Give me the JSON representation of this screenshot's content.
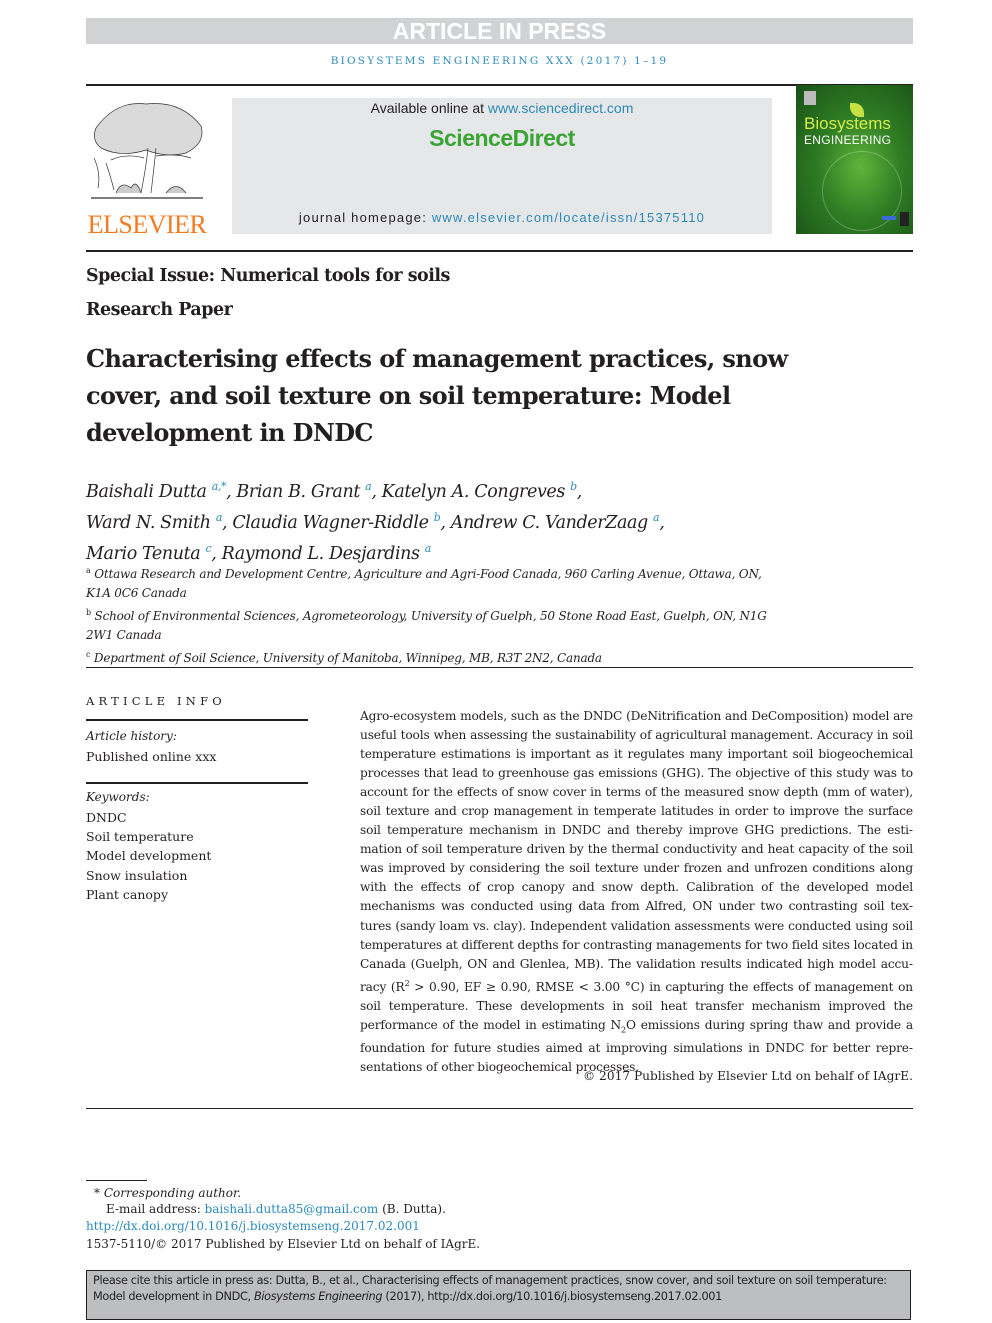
{
  "banner": {
    "article_in_press": "ARTICLE IN PRESS"
  },
  "running_head": "BIOSYSTEMS ENGINEERING XXX (2017) 1–19",
  "masthead": {
    "publisher_logo_text": "ELSEVIER",
    "available_online_prefix": "Available online at ",
    "available_online_url": "www.sciencedirect.com",
    "platform_name": "ScienceDirect",
    "journal_homepage_prefix": "journal homepage: ",
    "journal_homepage_url": "www.elsevier.com/locate/issn/15375110",
    "cover": {
      "title_line1": "Biosystems",
      "title_line2": "ENGINEERING"
    }
  },
  "article": {
    "special_issue": "Special Issue: Numerical tools for soils",
    "article_type": "Research Paper",
    "title": "Characterising effects of management practices, snow cover, and soil texture on soil temperature: Model development in DNDC",
    "authors": [
      {
        "name": "Baishali Dutta",
        "sup": "a,*",
        "sep": ", "
      },
      {
        "name": "Brian B. Grant",
        "sup": "a",
        "sep": ", "
      },
      {
        "name": "Katelyn A. Congreves",
        "sup": "b",
        "sep": ", "
      },
      {
        "name": "Ward N. Smith",
        "sup": "a",
        "sep": ", "
      },
      {
        "name": "Claudia Wagner-Riddle",
        "sup": "b",
        "sep": ", "
      },
      {
        "name": "Andrew C. VanderZaag",
        "sup": "a",
        "sep": ", "
      },
      {
        "name": "Mario Tenuta",
        "sup": "c",
        "sep": ", "
      },
      {
        "name": "Raymond L. Desjardins",
        "sup": "a",
        "sep": ""
      }
    ],
    "affiliations": [
      {
        "key": "a",
        "text": "Ottawa Research and Development Centre, Agriculture and Agri-Food Canada, 960 Carling Avenue, Ottawa, ON, K1A 0C6 Canada"
      },
      {
        "key": "b",
        "text": "School of Environmental Sciences, Agrometeorology, University of Guelph, 50 Stone Road East, Guelph, ON, N1G 2W1 Canada"
      },
      {
        "key": "c",
        "text": "Department of Soil Science, University of Manitoba, Winnipeg, MB, R3T 2N2, Canada"
      }
    ]
  },
  "article_info": {
    "heading": "ARTICLE INFO",
    "history_label": "Article history:",
    "history_value": "Published online xxx",
    "keywords_label": "Keywords:",
    "keywords": [
      "DNDC",
      "Soil temperature",
      "Model development",
      "Snow insulation",
      "Plant canopy"
    ]
  },
  "abstract": {
    "part1": "Agro-ecosystem models, such as the DNDC (DeNitrification and DeComposition) model are useful tools when assessing the sustainability of agricultural management. Accuracy in soil temperature estimations is important as it regulates many important soil biogeochemical processes that lead to greenhouse gas emissions (GHG). The objective of this study was to account for the effects of snow cover in terms of the measured snow depth (mm of water), soil texture and crop management in temperate latitudes in order to improve the surface soil temperature mechanism in DNDC and thereby improve GHG predictions. The esti­mation of soil temperature driven by the thermal conductivity and heat capacity of the soil was improved by considering the soil texture under frozen and unfrozen conditions along with the effects of crop canopy and snow depth. Calibration of the developed model mechanisms was conducted using data from Alfred, ON under two contrasting soil tex­tures (sandy loam vs. clay). Independent validation assessments were conducted using soil temperatures at different depths for contrasting managements for two field sites located in Canada (Guelph, ON and Glenlea, MB). The validation results indicated high model accu­racy (R",
    "r2_sup": "2",
    "part2": " > 0.90, EF ≥ 0.90, RMSE < 3.00 °C) in capturing the effects of management on soil temperature. These developments in soil heat transfer mechanism improved the perfor­mance of the model in estimating N",
    "n2o_sub": "2",
    "part3": "O emissions during spring thaw and provide a foundation for future studies aimed at improving simulations in DNDC for better repre­sentations of other biogeochemical processes.",
    "copyright": "© 2017 Published by Elsevier Ltd on behalf of IAgrE."
  },
  "footnotes": {
    "corresponding": "* Corresponding author.",
    "email_prefix": "E-mail address: ",
    "email": "baishali.dutta85@gmail.com",
    "email_suffix": " (B. Dutta).",
    "doi": "http://dx.doi.org/10.1016/j.biosystemseng.2017.02.001",
    "issn_line": "1537-5110/© 2017 Published by Elsevier Ltd on behalf of IAgrE."
  },
  "citation_box": {
    "prefix": "Please cite this article in press as: Dutta, B., et al., Characterising effects of management practices, snow cover, and soil texture on soil temperature: Model development in DNDC, ",
    "journal": "Biosystems Engineering",
    "suffix": " (2017), http://dx.doi.org/10.1016/j.biosystemseng.2017.02.001"
  }
}
